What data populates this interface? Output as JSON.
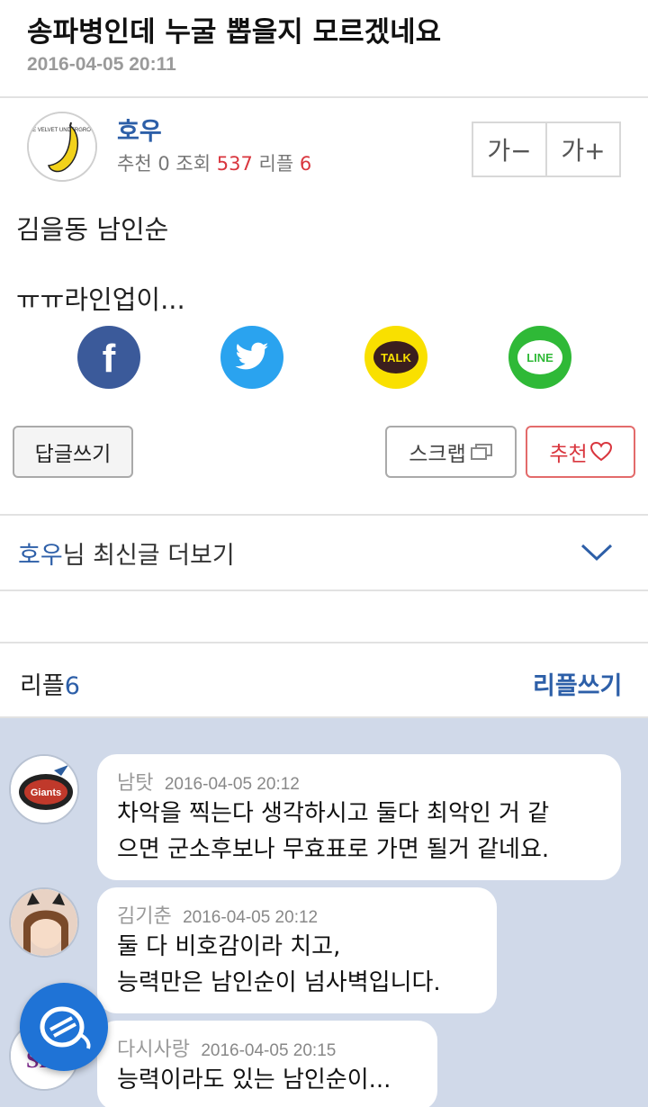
{
  "post": {
    "title": "송파병인데 누굴 뽑을지 모르겠네요",
    "date": "2016-04-05 20:11",
    "author": "호우",
    "stats": {
      "rec_label": "추천",
      "rec": "0",
      "views_label": "조회",
      "views": "537",
      "replies_label": "리플",
      "replies": "6"
    },
    "body": [
      "김을동 남인순",
      "ㅠㅠ라인업이..."
    ]
  },
  "font_controls": {
    "decrease": "가−",
    "increase": "가+"
  },
  "share": [
    {
      "icon": "facebook-icon",
      "label": "f",
      "color": "#3b5a9a"
    },
    {
      "icon": "twitter-icon",
      "color": "#2aa3ef"
    },
    {
      "icon": "kakaotalk-icon",
      "label": "TALK",
      "color": "#f9e000"
    },
    {
      "icon": "line-icon",
      "label": "LINE",
      "color": "#2fb937"
    }
  ],
  "actions": {
    "reply": "답글쓰기",
    "scrap": "스크랩",
    "recommend": "추천"
  },
  "more_posts": {
    "author": "호우",
    "suffix": "님 최신글 더보기"
  },
  "replies_header": {
    "label": "리플",
    "count": "6",
    "write": "리플쓰기"
  },
  "comments": [
    {
      "name": "남탓",
      "time": "2016-04-05 20:12",
      "lines": [
        "차악을 찍는다 생각하시고 둘다 최악인 거 같",
        "으면 군소후보나 무효표로 가면 될거 같네요."
      ]
    },
    {
      "name": "김기춘",
      "time": "2016-04-05 20:12",
      "lines": [
        "둘 다 비호감이라 치고,",
        "능력만은 남인순이 넘사벽입니다."
      ]
    },
    {
      "name": "다시사랑",
      "time": "2016-04-05 20:15",
      "lines": [
        "능력이라도 있는 남인순이..."
      ]
    }
  ],
  "colors": {
    "accent": "#2d5fa8",
    "highlight": "#d9363e",
    "comment_bg": "#d0d9e9",
    "fab": "#1f73d6"
  }
}
